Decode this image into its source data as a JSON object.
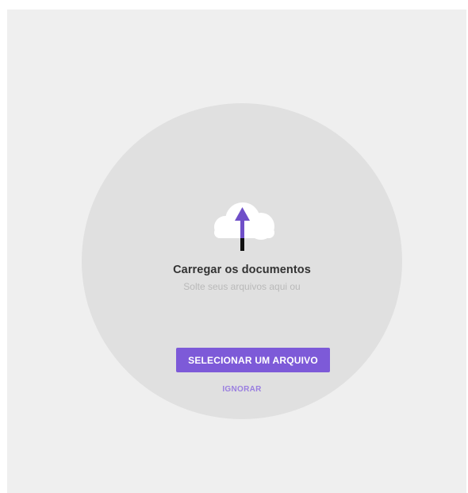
{
  "upload": {
    "icon": "cloud-upload-icon",
    "title": "Carregar os documentos",
    "subtitle": "Solte seus arquivos aqui ou",
    "select_button_label": "SELECIONAR UM ARQUIVO",
    "skip_label": "IGNORAR"
  },
  "colors": {
    "background": "#efefef",
    "dropzone": "#e0e0e0",
    "accent": "#7d5ad8",
    "skip_link": "#9a7fe0",
    "title": "#333333",
    "subtitle": "#b9b9b9"
  }
}
